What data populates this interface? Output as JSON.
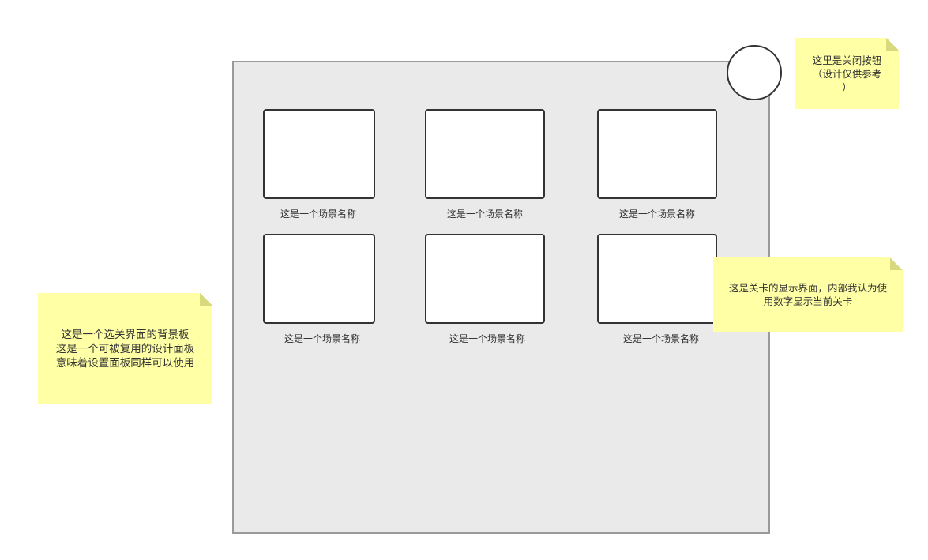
{
  "levels": [
    {
      "label": "这是一个场景名称"
    },
    {
      "label": "这是一个场景名称"
    },
    {
      "label": "这是一个场景名称"
    },
    {
      "label": "这是一个场景名称"
    },
    {
      "label": "这是一个场景名称"
    },
    {
      "label": "这是一个场景名称"
    }
  ],
  "notes": {
    "close_button": "这里是关闭按钮\n（设计仅供参考\n）",
    "level_display": "这是关卡的显示界面，内部我认为使\n用数字显示当前关卡",
    "background_panel": "这是一个选关界面的背景板\n这是一个可被复用的设计面板\n意味着设置面板同样可以使用"
  },
  "colors": {
    "panel_fill": "#eaeaea",
    "panel_border": "#9a9a9a",
    "note_fill": "#ffffa6",
    "slot_fill": "#ffffff",
    "outline": "#333333"
  }
}
